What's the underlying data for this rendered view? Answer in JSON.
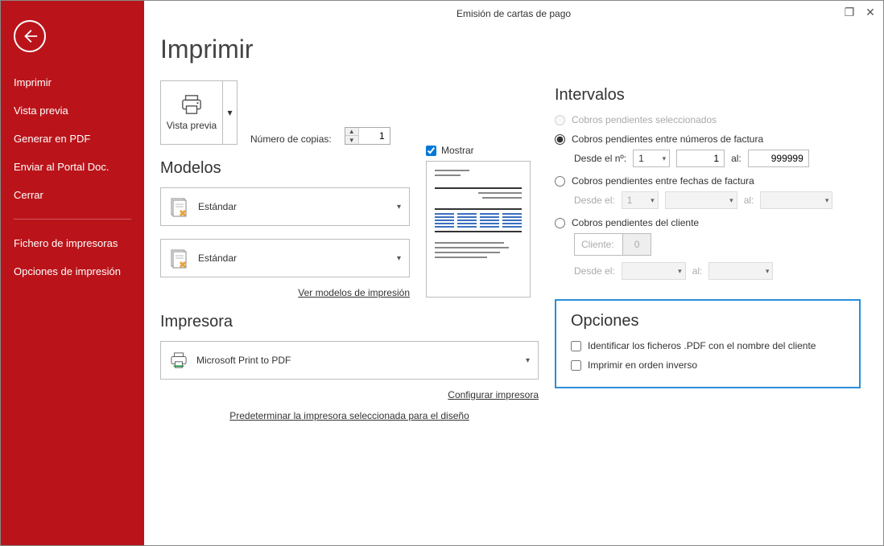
{
  "window_title": "Emisión de cartas de pago",
  "sidebar": {
    "items": [
      "Imprimir",
      "Vista previa",
      "Generar en PDF",
      "Enviar al Portal Doc.",
      "Cerrar"
    ],
    "items2": [
      "Fichero de impresoras",
      "Opciones de impresión"
    ]
  },
  "main": {
    "heading": "Imprimir",
    "vista_previa_label": "Vista previa",
    "copies_label": "Número de copias:",
    "copies_value": "1",
    "modelos_heading": "Modelos",
    "mostrar_label": "Mostrar",
    "model1": "Estándar",
    "model2": "Estándar",
    "ver_modelos_link": "Ver modelos de impresión",
    "impresora_heading": "Impresora",
    "printer_name": "Microsoft Print to PDF",
    "config_link": "Configurar impresora",
    "predeterminar_link": "Predeterminar la impresora seleccionada para el diseño"
  },
  "intervalos": {
    "heading": "Intervalos",
    "r1_label": "Cobros pendientes seleccionados",
    "r2_label": "Cobros pendientes entre números de factura",
    "r2_desde_label": "Desde el nº:",
    "r2_desde_sel": "1",
    "r2_desde_num": "1",
    "r2_al_label": "al:",
    "r2_al_num": "999999",
    "r3_label": "Cobros pendientes entre fechas de factura",
    "r3_desde_label": "Desde el:",
    "r3_desde_sel": "1",
    "r3_al_label": "al:",
    "r4_label": "Cobros pendientes del cliente",
    "r4_cliente_label": "Cliente:",
    "r4_cliente_num": "0",
    "r4_desde_label": "Desde el:",
    "r4_al_label": "al:"
  },
  "opciones": {
    "heading": "Opciones",
    "chk1": "Identificar los ficheros .PDF con el nombre del cliente",
    "chk2": "Imprimir en orden inverso"
  }
}
